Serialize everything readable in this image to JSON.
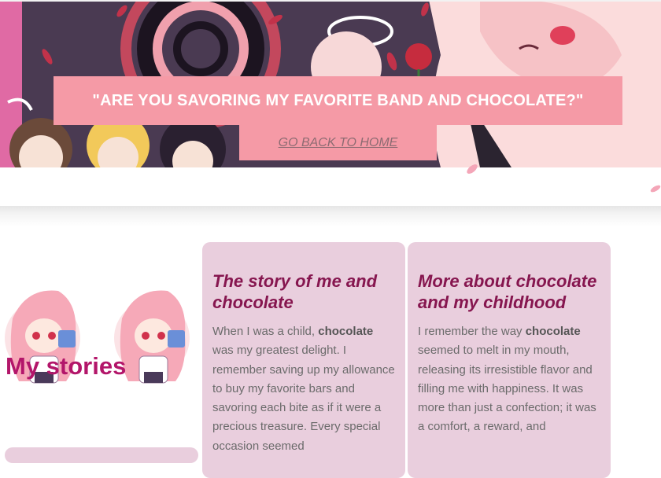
{
  "header": {
    "title": "\"ARE YOU SAVORING MY FAVORITE BAND AND CHOCOLATE?\"",
    "home_link": "GO BACK TO HOME"
  },
  "section": {
    "title": "My stories"
  },
  "cards": [
    {
      "title": "The story of me and chocolate",
      "text_before": "When I was a child, ",
      "highlight": "chocolate",
      "text_after": " was my greatest delight. I remember saving up my allowance to buy my favorite bars and savoring each bite as if it were a precious treasure. Every special occasion seemed"
    },
    {
      "title": "More about chocolate and my childhood",
      "text_before": "I remember the way ",
      "highlight": "chocolate",
      "text_after": " seemed to melt in my mouth, releasing its irresistible flavor and filling me with happiness. It was more than just a confection; it was a comfort, a reward, and"
    }
  ],
  "colors": {
    "banner_box": "#f59aa6",
    "section_title": "#b3166a",
    "card_bg": "#e9cedd",
    "card_title": "#86164f"
  }
}
